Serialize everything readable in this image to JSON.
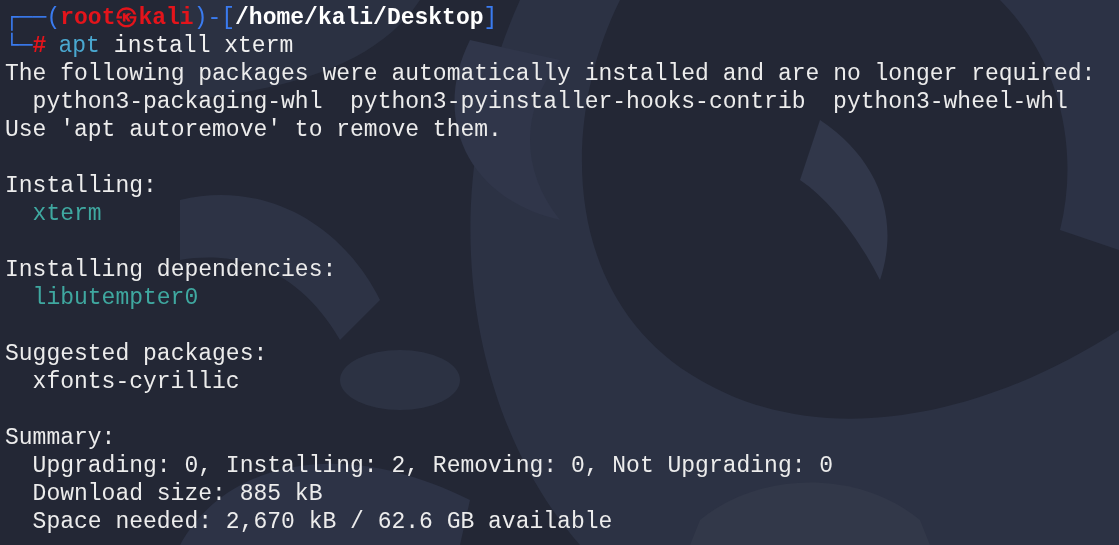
{
  "prompt": {
    "segments": [
      {
        "kind": "frame",
        "text": "┌──("
      },
      {
        "kind": "user",
        "text": "root㉿kali"
      },
      {
        "kind": "frame",
        "text": ")-["
      },
      {
        "kind": "path",
        "text": "/home/kali/Desktop"
      },
      {
        "kind": "frame",
        "text": "]"
      }
    ],
    "command": [
      {
        "kind": "frame",
        "text": "└─"
      },
      {
        "kind": "hash",
        "text": "#"
      },
      {
        "kind": "program",
        "text": "apt"
      },
      {
        "kind": "args",
        "text": "install xterm"
      }
    ]
  },
  "output_blocks": [
    {
      "lines": [
        {
          "kind": "text",
          "text": "The following packages were automatically installed and are no longer required:"
        },
        {
          "kind": "detail",
          "text": "python3-packaging-whl  python3-pyinstaller-hooks-contrib  python3-wheel-whl"
        },
        {
          "kind": "text",
          "text": "Use 'apt autoremove' to remove them."
        }
      ]
    },
    {
      "lines": [
        {
          "kind": "text",
          "text": "Installing:"
        },
        {
          "kind": "package",
          "text": "xterm"
        }
      ]
    },
    {
      "lines": [
        {
          "kind": "text",
          "text": "Installing dependencies:"
        },
        {
          "kind": "package",
          "text": "libutempter0"
        }
      ]
    },
    {
      "lines": [
        {
          "kind": "text",
          "text": "Suggested packages:"
        },
        {
          "kind": "detail",
          "text": "xfonts-cyrillic"
        }
      ]
    },
    {
      "lines": [
        {
          "kind": "text",
          "text": "Summary:"
        },
        {
          "kind": "detail",
          "text": "Upgrading: 0, Installing: 2, Removing: 0, Not Upgrading: 0"
        },
        {
          "kind": "detail",
          "text": "Download size: 885 kB"
        },
        {
          "kind": "detail",
          "text": "Space needed: 2,670 kB / 62.6 GB available"
        }
      ]
    }
  ]
}
